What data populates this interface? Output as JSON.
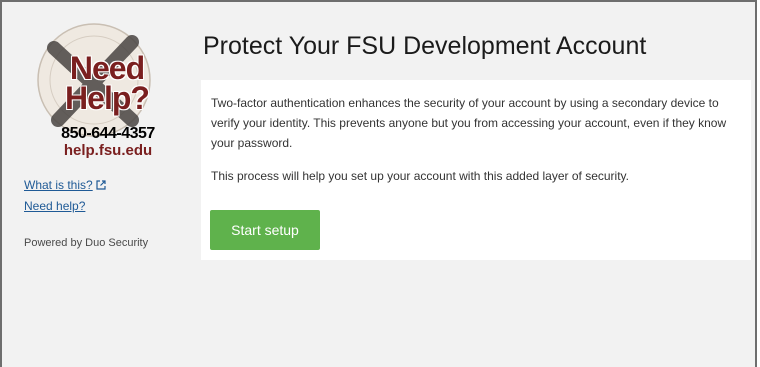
{
  "sidebar": {
    "logo": {
      "line1": "Need",
      "line2": "Help?",
      "phone": "850-644-4357",
      "url": "help.fsu.edu"
    },
    "links": [
      {
        "label": "What is this?",
        "icon": "external-link-icon"
      },
      {
        "label": "Need help?"
      }
    ],
    "powered_by": "Powered by Duo Security"
  },
  "main": {
    "title": "Protect Your FSU Development Account",
    "paragraph1": "Two-factor authentication enhances the security of your account by using a secondary device to verify your identity. This prevents anyone but you from accessing your account, even if they know your password.",
    "paragraph2": "This process will help you set up your account with this added layer of security.",
    "start_button": "Start setup"
  },
  "colors": {
    "accent_green": "#5fb24c",
    "link_blue": "#1f5a96",
    "garnet": "#7a1f1f",
    "background": "#f2f2f2"
  }
}
